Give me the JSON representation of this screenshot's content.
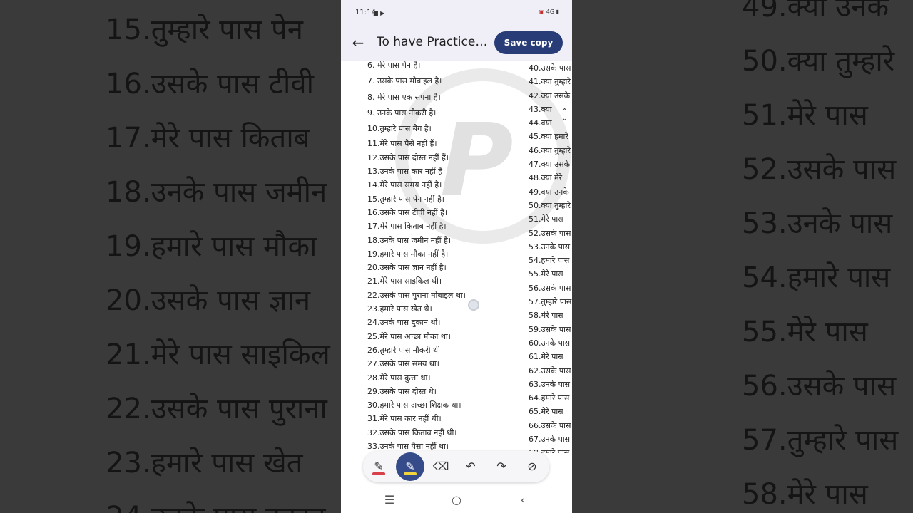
{
  "status_bar": {
    "time": "11:14",
    "left_icons": "■ ▶",
    "right_icons": "4G ▮"
  },
  "app_bar": {
    "back_icon": "arrow-back-icon",
    "title": "To have Practice_...",
    "save_label": "Save copy",
    "accent": "#283d78"
  },
  "document": {
    "column1": [
      "6.  मेरे पास पेन है।",
      "7.  उसके पास मोबाइल है।",
      "8.  मेरे पास एक सपना है।",
      "9.  उनके पास नौकरी है।",
      "10.तुम्हारे पास बैग है।",
      "11.मेरे पास पैसे नहीं हैं।",
      "12.उसके पास दोस्त नहीं हैं।",
      "13.उनके पास कार नहीं है।",
      "14.मेरे पास समय नहीं है।",
      "15.तुम्हारे पास पेन नहीं है।",
      "16.उसके पास टीवी नहीं है।",
      "17.मेरे पास किताब नहीं है।",
      "18.उनके पास जमीन नहीं है।",
      "19.हमारे पास मौका नहीं है।",
      "20.उसके पास ज्ञान नहीं है।",
      "21.मेरे पास साइकिल थी।",
      "22.उसके पास पुराना मोबाइल था।",
      "23.हमारे पास खेत थे।",
      "24.उनके पास दुकान थी।",
      "25.मेरे पास अच्छा मौका था।",
      "26.तुम्हारे पास नौकरी थी।",
      "27.उसके पास समय था।",
      "28.मेरे पास कुत्ता था।",
      "29.उसके पास दोस्त थे।",
      "30.हमारे पास अच्छा शिक्षक था।",
      "31.मेरे पास कार नहीं थी।",
      "32.उसके पास किताब नहीं थी।",
      "33.उनके पास पैसा नहीं था।"
    ],
    "column2": [
      "40.उसके पास",
      "41.क्या तुम्हारे",
      "42.क्या उसके",
      "43.क्या",
      "44.क्या",
      "45.क्या हमारे",
      "46.क्या तुम्हारे",
      "47.क्या उसके",
      "48.क्या मेरे",
      "49.क्या उनके",
      "50.क्या तुम्हारे",
      "51.मेरे पास",
      "52.उसके पास",
      "53.उनके पास",
      "54.हमारे पास",
      "55.मेरे पास",
      "56.उसके पास",
      "57.तुम्हारे पास",
      "58.मेरे पास",
      "59.उसके पास",
      "60.उनके पास",
      "61.मेरे पास",
      "62.उसके पास",
      "63.उनके पास",
      "64.हमारे पास",
      "65.मेरे पास",
      "66.उसके पास",
      "67.उनके पास",
      "68.हमारे पास"
    ],
    "highlight_color": "#f6ee9a"
  },
  "toolbar": {
    "tools": [
      {
        "icon": "pen-icon",
        "color": "#d8404a"
      },
      {
        "icon": "highlighter-icon",
        "color": "#f2d43c",
        "active": true
      },
      {
        "icon": "eraser-icon"
      },
      {
        "icon": "undo-icon"
      },
      {
        "icon": "redo-icon"
      },
      {
        "icon": "hide-annotations-icon"
      }
    ]
  },
  "nav_bar": {
    "icons": [
      "recents-icon",
      "home-icon",
      "back-icon"
    ]
  },
  "background": {
    "left_lines": [
      "15.तुम्हारे पास पेन",
      "16.उसके पास टीवी",
      "17.मेरे पास किताब",
      "18.उनके पास जमीन",
      "19.हमारे पास मौका",
      "20.उसके पास ज्ञान",
      "21.मेरे पास साइकिल",
      "22.उसके पास पुराना",
      "23.हमारे पास खेत",
      "24.उनके पास दुकान"
    ],
    "right_lines": [
      "49.क्या उनके",
      "50.क्या तुम्हारे",
      "51.मेरे पास",
      "52.उसके पास",
      "53.उनके पास",
      "54.हमारे पास",
      "55.मेरे पास",
      "56.उसके पास",
      "57.तुम्हारे पास",
      "58.मेरे पास"
    ]
  }
}
